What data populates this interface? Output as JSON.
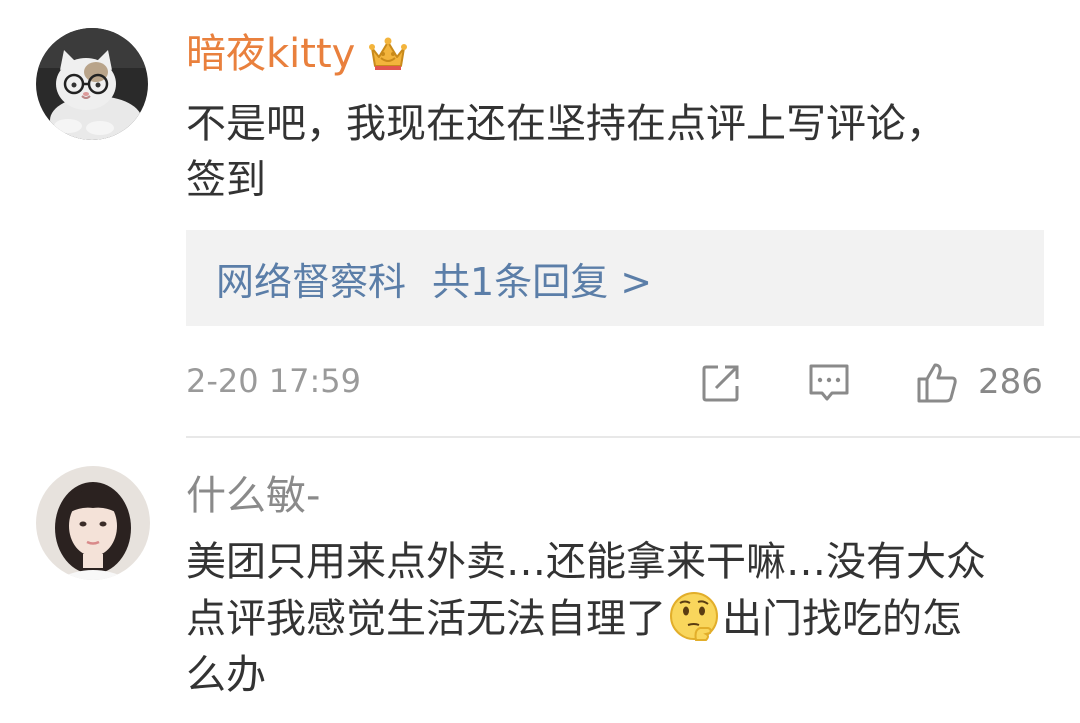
{
  "comments": [
    {
      "username": "暗夜kitty",
      "badge_icon": "crown-badge-icon",
      "text_lines": [
        "不是吧，我现在还在坚持在点评上写评论，",
        "签到"
      ],
      "reply": {
        "author": "网络督察科",
        "summary": "共1条回复 >"
      },
      "timestamp": "2-20 17:59",
      "like_count": "286",
      "colors": {
        "username": "#e9803d",
        "reply_link": "#5b7ea8"
      }
    },
    {
      "username": "什么敏-",
      "text_lines": [
        "美团只用来点外卖…还能拿来干嘛…没有大众",
        "点评我感觉生活无法自理了",
        "出门找吃的怎",
        "么办"
      ],
      "emoji_icon": "thinking-face-emoji-icon",
      "colors": {
        "username": "#8a8a8a"
      }
    }
  ]
}
